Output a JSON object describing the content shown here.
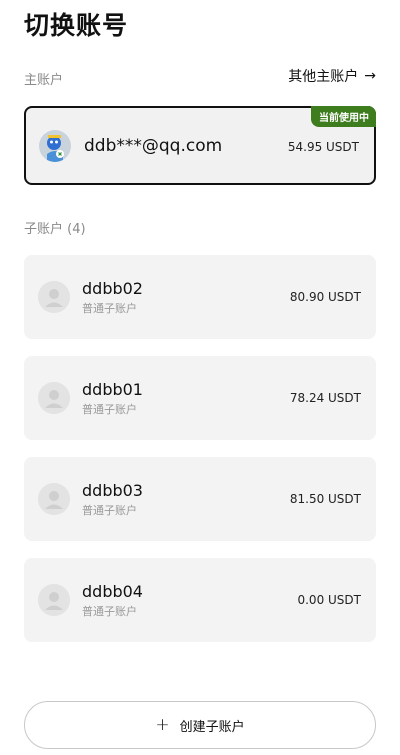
{
  "header": {
    "title": "切换账号"
  },
  "main_section": {
    "label": "主账户",
    "other_link": "其他主账户",
    "other_icon": "arrow-right-icon",
    "current_account": {
      "badge": "当前使用中",
      "name": "ddb***@qq.com",
      "amount": "54.95 USDT"
    }
  },
  "sub_section": {
    "label": "子账户 (4)",
    "accounts": [
      {
        "name": "ddbb02",
        "type": "普通子账户",
        "amount": "80.90 USDT"
      },
      {
        "name": "ddbb01",
        "type": "普通子账户",
        "amount": "78.24 USDT"
      },
      {
        "name": "ddbb03",
        "type": "普通子账户",
        "amount": "81.50 USDT"
      },
      {
        "name": "ddbb04",
        "type": "普通子账户",
        "amount": "0.00 USDT"
      }
    ]
  },
  "footer": {
    "create_label": "创建子账户",
    "create_icon": "plus-icon"
  },
  "colors": {
    "badge_bg": "#3e7d1e",
    "card_bg": "#f3f3f3",
    "accent_border": "#111111"
  }
}
